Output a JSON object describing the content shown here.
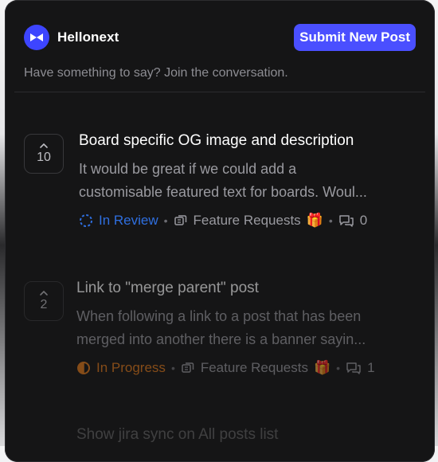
{
  "header": {
    "brand_name": "Hellonext",
    "submit_label": "Submit New Post",
    "tagline": "Have something to say? Join the conversation."
  },
  "posts": [
    {
      "votes": "10",
      "title": "Board specific OG image and description",
      "description_line1": "It would be great if we could add a",
      "description_line2": "customisable featured text for boards. Woul...",
      "status": "In Review",
      "status_color": "#2f6fe0",
      "board": "Feature Requests",
      "board_emoji": "🎁",
      "comments": "0"
    },
    {
      "votes": "2",
      "title": "Link to \"merge parent\" post",
      "description_line1": "When following a link to a post that has been",
      "description_line2": "merged into another there is a banner sayin...",
      "status": "In Progress",
      "status_color": "#e2791b",
      "board": "Feature Requests",
      "board_emoji": "🎁",
      "comments": "1"
    },
    {
      "title": "Show jira sync on All posts list"
    }
  ],
  "colors": {
    "accent": "#4a4fff",
    "card_background": "#151516"
  },
  "icons": {
    "logo": "hellonext-logo-icon",
    "upvote": "chevron-up-icon",
    "in_review": "dashed-circle-icon",
    "in_progress": "half-circle-icon",
    "board": "board-switch-icon",
    "comments": "comment-bubble-icon"
  }
}
